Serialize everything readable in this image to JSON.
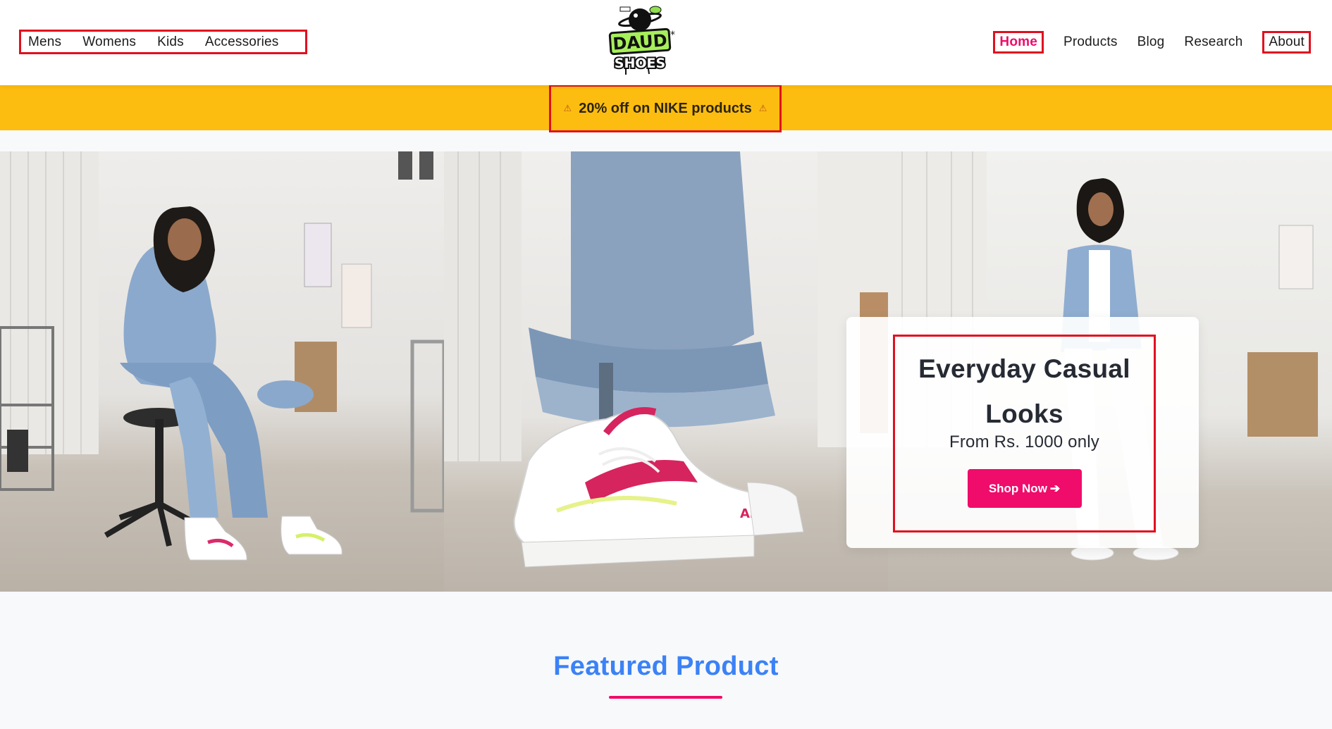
{
  "header": {
    "left_nav": [
      "Mens",
      "Womens",
      "Kids",
      "Accessories"
    ],
    "right_nav": [
      {
        "label": "Home",
        "active": true,
        "boxed": true
      },
      {
        "label": "Products",
        "active": false,
        "boxed": false
      },
      {
        "label": "Blog",
        "active": false,
        "boxed": false
      },
      {
        "label": "Research",
        "active": false,
        "boxed": false
      },
      {
        "label": "About",
        "active": false,
        "boxed": true
      }
    ],
    "logo_text": "DAUD SHOES"
  },
  "promo": {
    "text": "20% off on NIKE products",
    "icon": "warning-icon"
  },
  "hero": {
    "title": "Everyday Casual Looks",
    "subtitle": "From Rs. 1000 only",
    "cta_label": "Shop Now",
    "cta_icon": "arrow-right-icon"
  },
  "featured": {
    "title": "Featured Product"
  },
  "colors": {
    "accent_pink": "#ef0c6a",
    "promo_yellow": "#fdbd10",
    "featured_blue": "#3b82f6",
    "highlight_red": "#e0101f"
  }
}
